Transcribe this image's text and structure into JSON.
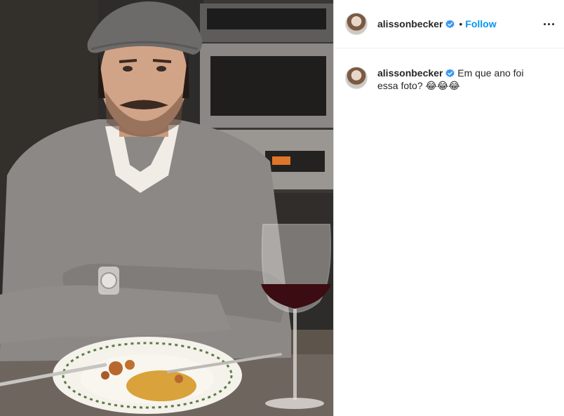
{
  "post": {
    "media_alt": "Man in gray flat cap and gray sweater seated at a table with a plate of pasta and a glass of red wine",
    "header": {
      "username": "alissonbecker",
      "separator": "•",
      "follow_label": "Follow",
      "verified_icon": "verified-badge-icon",
      "more_icon": "more-options-icon"
    },
    "caption": {
      "username": "alissonbecker",
      "text": "Em que ano foi essa foto?",
      "emoji": "😂😂😂"
    }
  },
  "colors": {
    "accent": "#0095f6",
    "text": "#262626",
    "border": "#dbdbdb",
    "verified": "#3897f0"
  }
}
